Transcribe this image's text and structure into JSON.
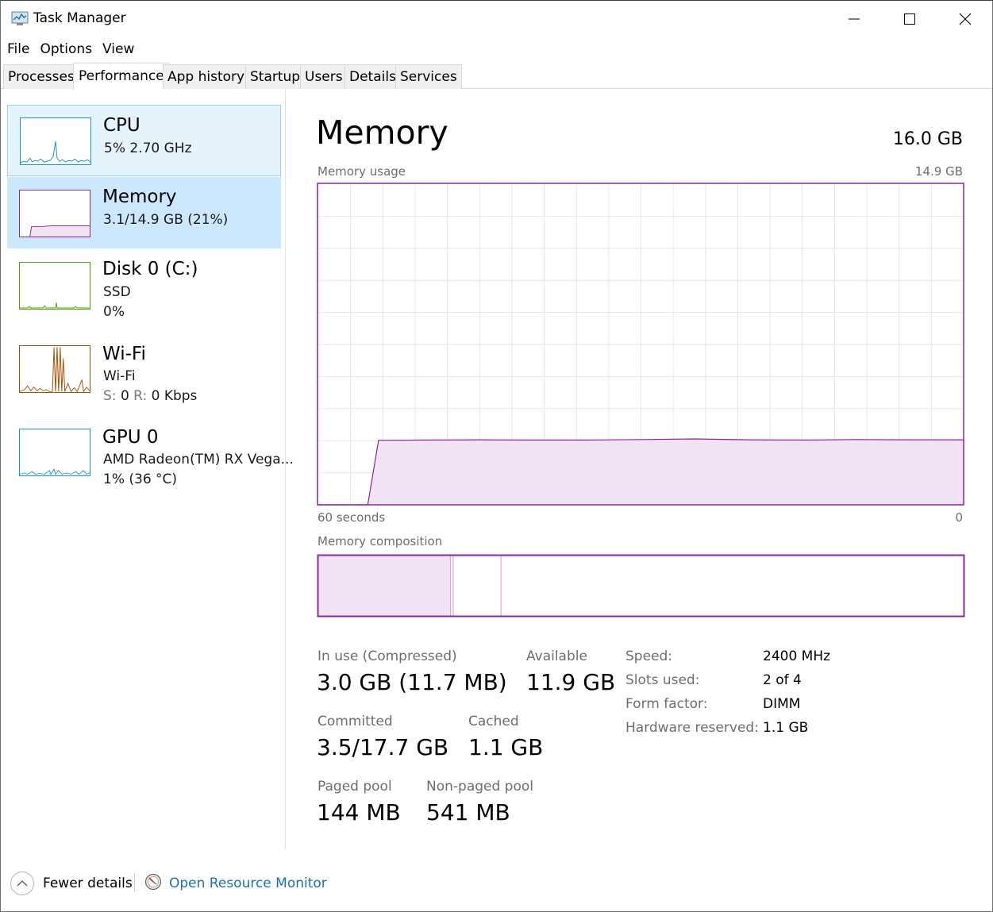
{
  "window": {
    "title": "Task Manager"
  },
  "menu": [
    "File",
    "Options",
    "View"
  ],
  "tabs": [
    {
      "label": "Processes"
    },
    {
      "label": "Performance"
    },
    {
      "label": "App history"
    },
    {
      "label": "Startup"
    },
    {
      "label": "Users"
    },
    {
      "label": "Details"
    },
    {
      "label": "Services"
    }
  ],
  "active_tab": "Performance",
  "resources": {
    "cpu": {
      "name": "CPU",
      "detail": "5%  2.70 GHz",
      "color": "#1c8fd8"
    },
    "memory": {
      "name": "Memory",
      "detail": "3.1/14.9 GB (21%)",
      "color": "#8b27a4"
    },
    "disk": {
      "name": "Disk 0 (C:)",
      "type": "SSD",
      "detail": "0%",
      "color": "#4da60c"
    },
    "wifi": {
      "name": "Wi-Fi",
      "type": "Wi-Fi",
      "send_label": "S:",
      "send_value": "0",
      "recv_label": "R:",
      "recv_value": "0 Kbps",
      "color": "#a74f01"
    },
    "gpu": {
      "name": "GPU 0",
      "model": "AMD Radeon(TM) RX Vega...",
      "detail": "1% (36 °C)",
      "color": "#1c8fd8"
    }
  },
  "memory_view": {
    "title": "Memory",
    "total": "16.0 GB",
    "usage_label": "Memory usage",
    "usage_max": "14.9 GB",
    "axis_left": "60 seconds",
    "axis_right": "0",
    "composition_label": "Memory composition",
    "stats": {
      "in_use_label": "In use (Compressed)",
      "in_use_value": "3.0 GB (11.7 MB)",
      "available_label": "Available",
      "available_value": "11.9 GB",
      "committed_label": "Committed",
      "committed_value": "3.5/17.7 GB",
      "cached_label": "Cached",
      "cached_value": "1.1 GB",
      "paged_label": "Paged pool",
      "paged_value": "144 MB",
      "nonpaged_label": "Non-paged pool",
      "nonpaged_value": "541 MB"
    },
    "properties": [
      {
        "label": "Speed:",
        "value": "2400 MHz"
      },
      {
        "label": "Slots used:",
        "value": "2 of 4"
      },
      {
        "label": "Form factor:",
        "value": "DIMM"
      },
      {
        "label": "Hardware reserved:",
        "value": "1.1 GB"
      }
    ]
  },
  "chart_data": {
    "type": "area",
    "title": "Memory usage",
    "xlabel": "",
    "ylabel": "",
    "x": [
      60,
      55.4,
      54.4,
      50,
      45,
      40,
      35,
      30,
      25,
      20,
      15,
      10,
      5,
      0
    ],
    "values": [
      0,
      0,
      3.0,
      3.01,
      3.02,
      3.01,
      3.01,
      3.03,
      3.06,
      3.02,
      3.01,
      3.03,
      3.02,
      3.02
    ],
    "xlim": [
      60,
      0
    ],
    "ylim": [
      0,
      14.9
    ],
    "grid": true,
    "color": "#8b27a4"
  },
  "composition": {
    "in_use_fraction": 0.205,
    "modified_fraction": 0.004,
    "standby_fraction": 0.074,
    "color": "#8b27a4"
  },
  "footer": {
    "fewer_details": "Fewer details",
    "open_resource_monitor": "Open Resource Monitor"
  }
}
